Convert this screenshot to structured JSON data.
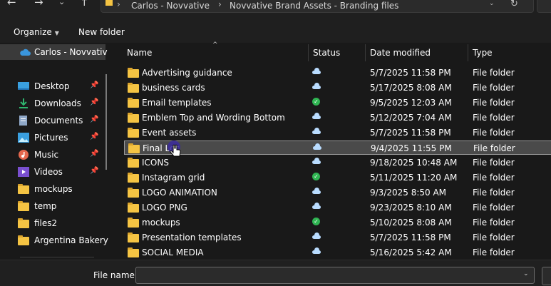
{
  "address": {
    "crumbs": [
      "Carlos - Novvative",
      "Novvative Brand Assets - Branding files"
    ],
    "separator": ">"
  },
  "toolbar": {
    "organize": "Organize",
    "new_folder": "New folder"
  },
  "sidebar": {
    "cloud": {
      "label": "Carlos - Novvativ",
      "icon": "onedrive-cloud-icon"
    },
    "items": [
      {
        "label": "Desktop",
        "icon": "desktop-icon",
        "pinned": true
      },
      {
        "label": "Downloads",
        "icon": "download-icon",
        "pinned": true
      },
      {
        "label": "Documents",
        "icon": "documents-icon",
        "pinned": true
      },
      {
        "label": "Pictures",
        "icon": "pictures-icon",
        "pinned": true
      },
      {
        "label": "Music",
        "icon": "music-icon",
        "pinned": true
      },
      {
        "label": "Videos",
        "icon": "videos-icon",
        "pinned": true
      },
      {
        "label": "mockups",
        "icon": "folder-icon",
        "pinned": false
      },
      {
        "label": "temp",
        "icon": "folder-icon",
        "pinned": false
      },
      {
        "label": "files2",
        "icon": "folder-icon",
        "pinned": false
      },
      {
        "label": "Argentina Bakery",
        "icon": "folder-icon",
        "pinned": false
      }
    ]
  },
  "columns": {
    "name": "Name",
    "status": "Status",
    "date": "Date modified",
    "type": "Type"
  },
  "files": [
    {
      "name": "Advertising guidance",
      "status": "cloud",
      "date": "5/7/2025 11:58 PM",
      "type": "File folder"
    },
    {
      "name": "business cards",
      "status": "cloud",
      "date": "5/17/2025 8:08 AM",
      "type": "File folder"
    },
    {
      "name": "Email templates",
      "status": "synced",
      "date": "9/5/2025 12:03 AM",
      "type": "File folder"
    },
    {
      "name": "Emblem Top and Wording Bottom",
      "status": "cloud",
      "date": "5/12/2025 7:04 AM",
      "type": "File folder"
    },
    {
      "name": "Event assets",
      "status": "cloud",
      "date": "5/7/2025 11:58 PM",
      "type": "File folder"
    },
    {
      "name": "Final Loc",
      "status": "cloud",
      "date": "9/4/2025 11:55 PM",
      "type": "File folder",
      "selected": true
    },
    {
      "name": "ICONS",
      "status": "cloud",
      "date": "9/18/2025 10:48 AM",
      "type": "File folder"
    },
    {
      "name": "Instagram grid",
      "status": "synced",
      "date": "5/11/2025 11:20 AM",
      "type": "File folder"
    },
    {
      "name": "LOGO ANIMATION",
      "status": "cloud",
      "date": "9/3/2025 8:50 AM",
      "type": "File folder"
    },
    {
      "name": "LOGO PNG",
      "status": "cloud",
      "date": "9/23/2025 8:10 AM",
      "type": "File folder"
    },
    {
      "name": "mockups",
      "status": "synced",
      "date": "5/10/2025 8:08 AM",
      "type": "File folder"
    },
    {
      "name": "Presentation templates",
      "status": "cloud",
      "date": "5/7/2025 11:58 PM",
      "type": "File folder"
    },
    {
      "name": "SOCIAL MEDIA",
      "status": "cloud",
      "date": "5/16/2025 5:42 AM",
      "type": "File folder"
    }
  ],
  "footer": {
    "file_name_label": "File name:",
    "file_name_value": ""
  },
  "colors": {
    "folder": "#f5c443",
    "cloud": "#b9dcff",
    "synced": "#2fb552",
    "accent": "#2b88d8"
  }
}
